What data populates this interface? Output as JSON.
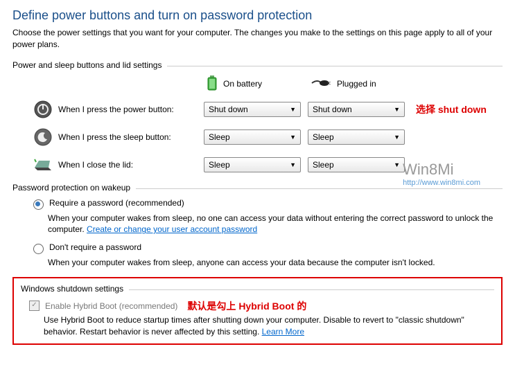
{
  "page": {
    "title": "Define power buttons and turn on password protection",
    "subtitle": "Choose the power settings that you want for your computer. The changes you make to the settings on this page apply to all of your power plans."
  },
  "section1": {
    "header": "Power and sleep buttons and lid settings",
    "col_battery": "On battery",
    "col_plugged": "Plugged in",
    "rows": {
      "power": {
        "label": "When I press the power button:",
        "battery": "Shut down",
        "plugged": "Shut down"
      },
      "sleep": {
        "label": "When I press the sleep button:",
        "battery": "Sleep",
        "plugged": "Sleep"
      },
      "lid": {
        "label": "When I close the lid:",
        "battery": "Sleep",
        "plugged": "Sleep"
      }
    }
  },
  "annotations": {
    "shutdown": "选择 shut down",
    "hybrid": "默认是勾上 Hybrid Boot 的"
  },
  "pw": {
    "header": "Password protection on wakeup",
    "opt1": {
      "label": "Require a password (recommended)",
      "desc": "When your computer wakes from sleep, no one can access your data without entering the correct password to unlock the computer. ",
      "link": "Create or change your user account password"
    },
    "opt2": {
      "label": "Don't require a password",
      "desc": "When your computer wakes from sleep, anyone can access your data because the computer isn't locked."
    }
  },
  "shutdown": {
    "header": "Windows shutdown settings",
    "cb_label": "Enable Hybrid Boot (recommended)",
    "desc": "Use Hybrid Boot to reduce startup times after shutting down your computer. Disable to revert to \"classic shutdown\" behavior. Restart behavior is never affected by this setting. ",
    "link": "Learn More"
  },
  "watermark": {
    "brand": "Win8Mi",
    "url": "http://www.win8mi.com"
  }
}
